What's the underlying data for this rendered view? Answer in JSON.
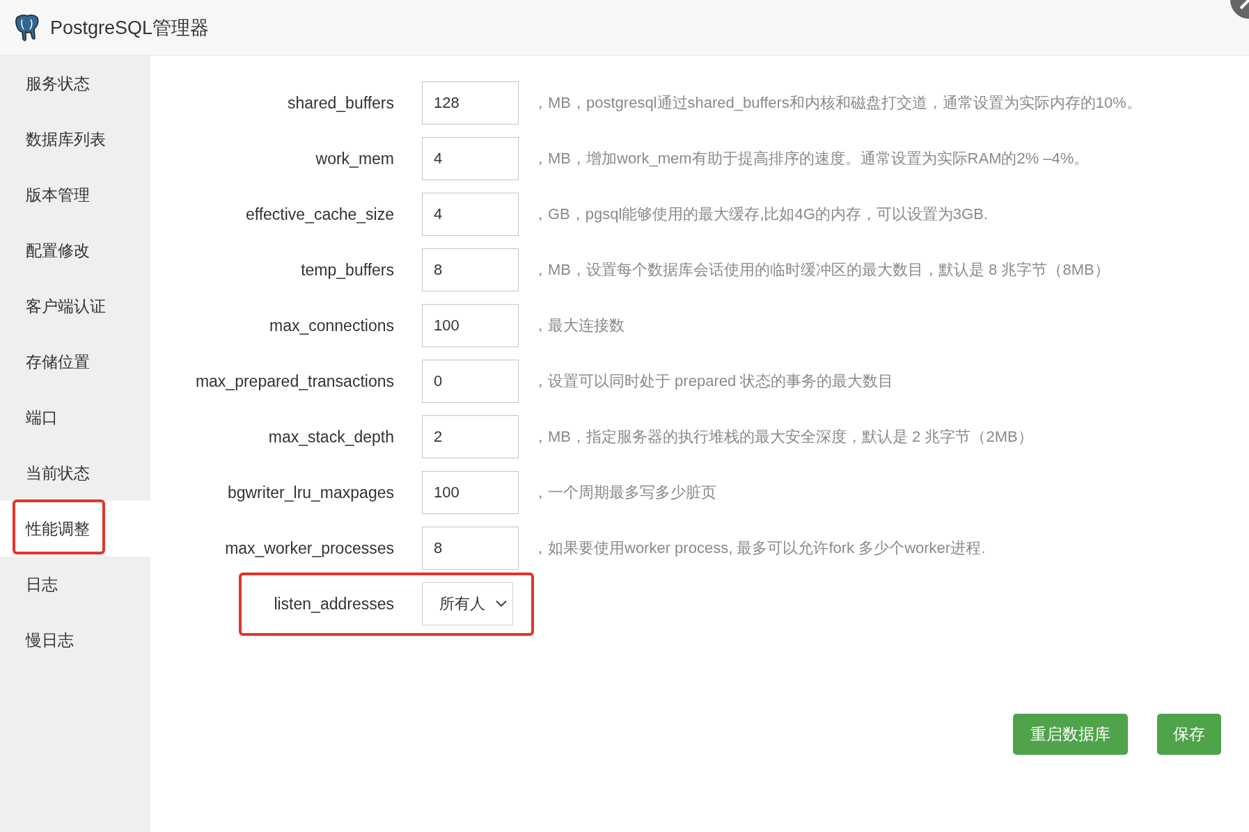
{
  "window": {
    "title": "PostgreSQL管理器"
  },
  "sidebar": {
    "items": [
      {
        "label": "服务状态",
        "selected": false,
        "annotated": false
      },
      {
        "label": "数据库列表",
        "selected": false,
        "annotated": false
      },
      {
        "label": "版本管理",
        "selected": false,
        "annotated": false
      },
      {
        "label": "配置修改",
        "selected": false,
        "annotated": false
      },
      {
        "label": "客户端认证",
        "selected": false,
        "annotated": false
      },
      {
        "label": "存储位置",
        "selected": false,
        "annotated": false
      },
      {
        "label": "端口",
        "selected": false,
        "annotated": false
      },
      {
        "label": "当前状态",
        "selected": false,
        "annotated": false
      },
      {
        "label": "性能调整",
        "selected": true,
        "annotated": true
      },
      {
        "label": "日志",
        "selected": false,
        "annotated": false
      },
      {
        "label": "慢日志",
        "selected": false,
        "annotated": false
      }
    ]
  },
  "fields": [
    {
      "label": "shared_buffers",
      "kind": "input",
      "value": "128",
      "note": "，MB，postgresql通过shared_buffers和内核和磁盘打交道，通常设置为实际内存的10%。",
      "annotated": false
    },
    {
      "label": "work_mem",
      "kind": "input",
      "value": "4",
      "note": "，MB，增加work_mem有助于提高排序的速度。通常设置为实际RAM的2% –4%。",
      "annotated": false
    },
    {
      "label": "effective_cache_size",
      "kind": "input",
      "value": "4",
      "note": "，GB，pgsql能够使用的最大缓存,比如4G的内存，可以设置为3GB.",
      "annotated": false
    },
    {
      "label": "temp_buffers",
      "kind": "input",
      "value": "8",
      "note": "，MB，设置每个数据库会话使用的临时缓冲区的最大数目，默认是 8 兆字节（8MB）",
      "annotated": false
    },
    {
      "label": "max_connections",
      "kind": "input",
      "value": "100",
      "note": "，最大连接数",
      "annotated": false
    },
    {
      "label": "max_prepared_transactions",
      "kind": "input",
      "value": "0",
      "note": "，设置可以同时处于 prepared 状态的事务的最大数目",
      "annotated": false
    },
    {
      "label": "max_stack_depth",
      "kind": "input",
      "value": "2",
      "note": "，MB，指定服务器的执行堆栈的最大安全深度，默认是 2 兆字节（2MB）",
      "annotated": false
    },
    {
      "label": "bgwriter_lru_maxpages",
      "kind": "input",
      "value": "100",
      "note": "，一个周期最多写多少脏页",
      "annotated": false
    },
    {
      "label": "max_worker_processes",
      "kind": "input",
      "value": "8",
      "note": "，如果要使用worker process, 最多可以允许fork 多少个worker进程.",
      "annotated": false
    },
    {
      "label": "listen_addresses",
      "kind": "select",
      "value": "所有人",
      "annotated": true
    }
  ],
  "buttons": [
    "重启数据库",
    "保存"
  ]
}
